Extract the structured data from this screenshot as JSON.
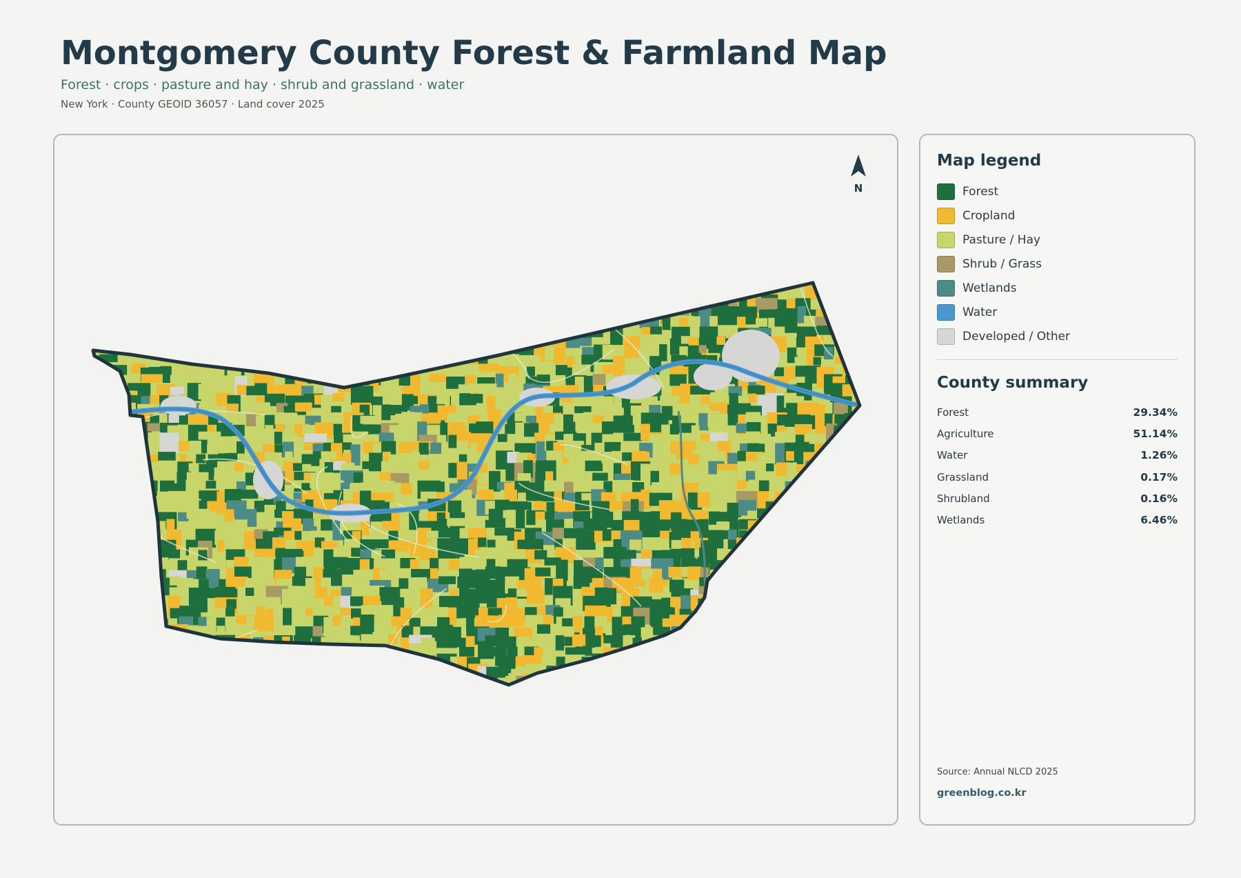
{
  "header": {
    "title": "Montgomery County Forest & Farmland Map",
    "subtitle": "Forest · crops · pasture and hay · shrub and grassland · water",
    "meta": "New York · County GEOID 36057 · Land cover 2025"
  },
  "map": {
    "north_label": "N",
    "colors": {
      "forest": "#1f6e3d",
      "cropland": "#f1b92f",
      "pasture": "#c8d56b",
      "shrub": "#a89a64",
      "wetlands": "#4c8b86",
      "water": "#4a96cf",
      "developed": "#d6d6d4",
      "boundary": "#1f343d"
    }
  },
  "legend": {
    "heading": "Map legend",
    "items": [
      {
        "label": "Forest",
        "color": "#1f6e3d"
      },
      {
        "label": "Cropland",
        "color": "#f1b92f"
      },
      {
        "label": "Pasture / Hay",
        "color": "#c8d56b"
      },
      {
        "label": "Shrub / Grass",
        "color": "#a89a64"
      },
      {
        "label": "Wetlands",
        "color": "#4c8b86"
      },
      {
        "label": "Water",
        "color": "#4a96cf"
      },
      {
        "label": "Developed / Other",
        "color": "#d6d6d4"
      }
    ]
  },
  "summary": {
    "heading": "County summary",
    "rows": [
      {
        "label": "Forest",
        "value": "29.34%"
      },
      {
        "label": "Agriculture",
        "value": "51.14%"
      },
      {
        "label": "Water",
        "value": "1.26%"
      },
      {
        "label": "Grassland",
        "value": "0.17%"
      },
      {
        "label": "Shrubland",
        "value": "0.16%"
      },
      {
        "label": "Wetlands",
        "value": "6.46%"
      }
    ]
  },
  "footer": {
    "source": "Source: Annual NLCD 2025",
    "credit": "greenblog.co.kr"
  }
}
